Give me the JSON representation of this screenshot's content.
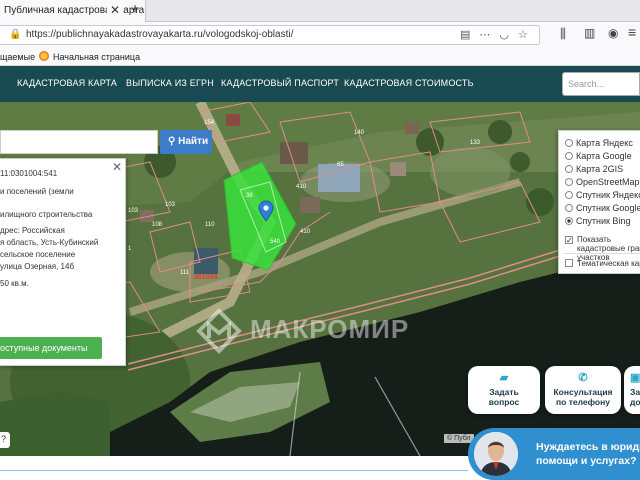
{
  "browser": {
    "tab_title": "Публичная кадастровая карта",
    "url": "https://publichnayakadastrovayakarta.ru/vologodskoj-oblasti/",
    "bookmarks": [
      "щаемые",
      "Начальная страница"
    ]
  },
  "site": {
    "nav": [
      "КАДАСТРОВАЯ КАРТА",
      "ВЫПИСКА ИЗ ЕГРН",
      "КАДАСТРОВЫЙ ПАСПОРТ",
      "КАДАСТРОВАЯ СТОИМОСТЬ"
    ],
    "search_placeholder": "Search..."
  },
  "map": {
    "search_button": "Найти",
    "parcel_labels": [
      "154",
      "140",
      "133",
      "65",
      "103",
      "103",
      "108",
      "1",
      "110",
      "410",
      "410",
      "111",
      "301004",
      "38",
      "540"
    ],
    "popup": {
      "lines": [
        "11:0301004:541",
        "и поселений (земли",
        "",
        "илищного строительства",
        "",
        "дрес: Российская",
        "я область, Усть-Кубинский",
        "сельское поселение",
        "улица Озерная, 14б",
        "",
        "50 кв.м."
      ],
      "button": "оступные документы"
    },
    "layers": {
      "options": [
        "Карта Яндекс",
        "Карта Google",
        "Карта 2GIS",
        "OpenStreetMap",
        "Спутник Яндекс",
        "Спутник Google",
        "Спутник Bing"
      ],
      "selected": "Спутник Bing",
      "checkbox_1": "Показать кадастровые границы участков",
      "checkbox_2": "Тематическая карта"
    },
    "actions": [
      {
        "line1": "Задать",
        "line2": "вопрос"
      },
      {
        "line1": "Консультация",
        "line2": "по телефону"
      },
      {
        "line1": "За",
        "line2": "до"
      }
    ],
    "watermark": "МАКРОМИР",
    "attribution": "© Публ",
    "help_label": "?"
  },
  "chat": {
    "line1": "Нуждаетесь в юриди",
    "line2": "помощи и услугах?"
  },
  "colors": {
    "nav_bg": "#1a4a51",
    "search_btn": "#3d7cc9",
    "doc_btn": "#4caf50",
    "parcel_fill": "#39e23c",
    "chat_bg": "#2f8fcf",
    "pin": "#2f7fd6"
  }
}
